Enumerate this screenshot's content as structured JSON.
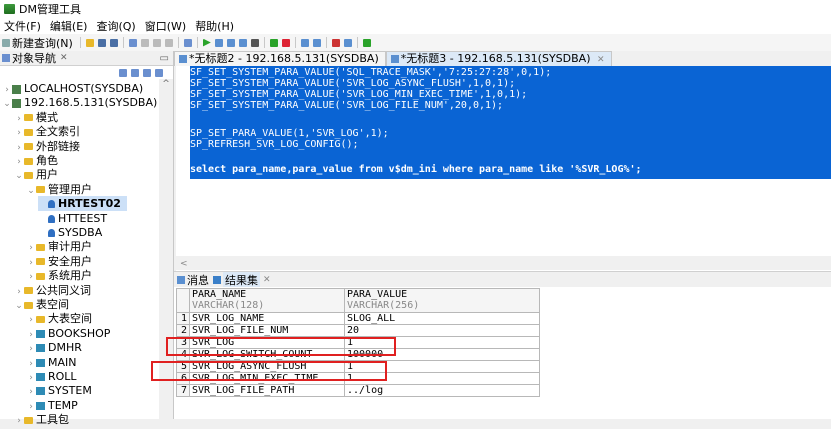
{
  "app": {
    "title": "DM管理工具"
  },
  "menu": [
    "文件(F)",
    "编辑(E)",
    "查询(Q)",
    "窗口(W)",
    "帮助(H)"
  ],
  "toolbar": {
    "new_query": "新建查询(N)"
  },
  "navigator": {
    "title": "对象导航",
    "tree": [
      {
        "label": "LOCALHOST(SYSDBA)",
        "level": 0,
        "icon": "db-icon",
        "twisty": ">"
      },
      {
        "label": "192.168.5.131(SYSDBA)",
        "level": 0,
        "icon": "db-icon",
        "twisty": "v"
      },
      {
        "label": "模式",
        "level": 1,
        "icon": "folder-icon",
        "twisty": ">"
      },
      {
        "label": "全文索引",
        "level": 1,
        "icon": "folder-icon",
        "twisty": ">"
      },
      {
        "label": "外部链接",
        "level": 1,
        "icon": "folder-icon",
        "twisty": ">"
      },
      {
        "label": "角色",
        "level": 1,
        "icon": "folder-icon",
        "twisty": ">"
      },
      {
        "label": "用户",
        "level": 1,
        "icon": "folder-icon",
        "twisty": "v"
      },
      {
        "label": "管理用户",
        "level": 2,
        "icon": "folder-icon",
        "twisty": "v"
      },
      {
        "label": "HRTEST02",
        "level": 3,
        "icon": "user-icon",
        "twisty": "",
        "selected": true
      },
      {
        "label": "HTTEEST",
        "level": 3,
        "icon": "user-icon",
        "twisty": ""
      },
      {
        "label": "SYSDBA",
        "level": 3,
        "icon": "user-icon",
        "twisty": ""
      },
      {
        "label": "审计用户",
        "level": 2,
        "icon": "folder-icon",
        "twisty": ">"
      },
      {
        "label": "安全用户",
        "level": 2,
        "icon": "folder-icon",
        "twisty": ">"
      },
      {
        "label": "系统用户",
        "level": 2,
        "icon": "folder-icon",
        "twisty": ">"
      },
      {
        "label": "公共同义词",
        "level": 1,
        "icon": "folder-icon",
        "twisty": ">"
      },
      {
        "label": "表空间",
        "level": 1,
        "icon": "folder-icon",
        "twisty": "v"
      },
      {
        "label": "大表空间",
        "level": 2,
        "icon": "folder-icon",
        "twisty": ">"
      },
      {
        "label": "BOOKSHOP",
        "level": 2,
        "icon": "tablespace-icon",
        "twisty": ">"
      },
      {
        "label": "DMHR",
        "level": 2,
        "icon": "tablespace-icon",
        "twisty": ">"
      },
      {
        "label": "MAIN",
        "level": 2,
        "icon": "tablespace-icon",
        "twisty": ">"
      },
      {
        "label": "ROLL",
        "level": 2,
        "icon": "tablespace-icon",
        "twisty": ">"
      },
      {
        "label": "SYSTEM",
        "level": 2,
        "icon": "tablespace-icon",
        "twisty": ">"
      },
      {
        "label": "TEMP",
        "level": 2,
        "icon": "tablespace-icon",
        "twisty": ">"
      },
      {
        "label": "工具包",
        "level": 1,
        "icon": "folder-icon",
        "twisty": ">"
      }
    ]
  },
  "tabs": [
    {
      "label": "*无标题2 - 192.168.5.131(SYSDBA)",
      "active": false
    },
    {
      "label": "*无标题3 - 192.168.5.131(SYSDBA)",
      "active": true
    }
  ],
  "editor": {
    "lines": [
      "SF_SET_SYSTEM_PARA_VALUE('SQL_TRACE_MASK','7:25:27:28',0,1);",
      "SF_SET_SYSTEM_PARA_VALUE('SVR_LOG_ASYNC_FLUSH',1,0,1);",
      "SF_SET_SYSTEM_PARA_VALUE('SVR_LOG_MIN_EXEC_TIME',1,0,1);",
      "SF_SET_SYSTEM_PARA_VALUE('SVR_LOG_FILE_NUM',20,0,1);",
      "",
      "SP_SET_PARA_VALUE(1,'SVR_LOG',1);",
      "SP_REFRESH_SVR_LOG_CONFIG();",
      "",
      "select para_name,para_value from v$dm_ini where para_name like '%SVR_LOG%';"
    ]
  },
  "results": {
    "tabs": [
      "消息",
      "结果集"
    ],
    "columns": [
      {
        "name": "PARA_NAME",
        "type": "VARCHAR(128)"
      },
      {
        "name": "PARA_VALUE",
        "type": "VARCHAR(256)"
      }
    ],
    "rows": [
      {
        "n": "1",
        "name": "SVR_LOG_NAME",
        "value": "SLOG_ALL"
      },
      {
        "n": "2",
        "name": "SVR_LOG_FILE_NUM",
        "value": "20"
      },
      {
        "n": "3",
        "name": "SVR_LOG",
        "value": "1"
      },
      {
        "n": "4",
        "name": "SVR_LOG_SWITCH_COUNT",
        "value": "100000"
      },
      {
        "n": "5",
        "name": "SVR_LOG_ASYNC_FLUSH",
        "value": "1"
      },
      {
        "n": "6",
        "name": "SVR_LOG_MIN_EXEC_TIME",
        "value": "1"
      },
      {
        "n": "7",
        "name": "SVR_LOG_FILE_PATH",
        "value": "../log"
      }
    ]
  },
  "colors": {
    "selection": "#0a64d4",
    "highlight_box": "#e02020"
  }
}
